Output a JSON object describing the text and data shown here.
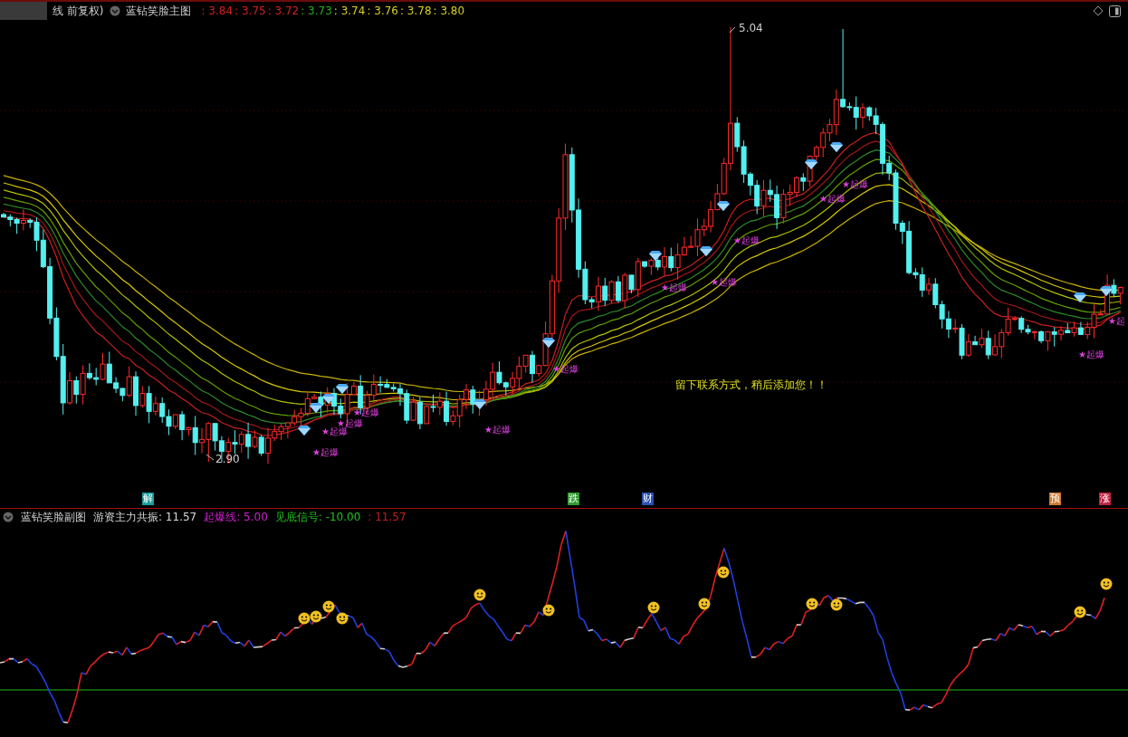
{
  "header": {
    "period": "线 前复权)",
    "indicator": "蓝钻笑脸主图",
    "values": [
      {
        "text": ": 3.84",
        "color": "#d42020"
      },
      {
        "text": ": 3.75",
        "color": "#d42020"
      },
      {
        "text": ": 3.72",
        "color": "#d42020"
      },
      {
        "text": ": 3.73",
        "color": "#20b020"
      },
      {
        "text": ": 3.74",
        "color": "#d8d020"
      },
      {
        "text": ": 3.76",
        "color": "#d8d020"
      },
      {
        "text": ": 3.78",
        "color": "#d8d020"
      },
      {
        "text": ": 3.80",
        "color": "#d8d020"
      }
    ]
  },
  "main_chart": {
    "high_label": "5.04",
    "low_label": "2.90",
    "note": "留下联系方式，稍后添加您！！",
    "signals": [
      {
        "label": "★起爆"
      },
      {
        "label": "★起爆"
      },
      {
        "label": "★起爆"
      },
      {
        "label": "★起爆"
      },
      {
        "label": "★起爆"
      },
      {
        "label": "★起爆"
      },
      {
        "label": "★起爆"
      },
      {
        "label": "★起爆"
      },
      {
        "label": "★起爆"
      },
      {
        "label": "★起爆"
      },
      {
        "label": "★起爆"
      },
      {
        "label": "★起爆"
      },
      {
        "label": "★起"
      }
    ]
  },
  "markers": [
    {
      "label": "解",
      "color": "#1a9c9c"
    },
    {
      "label": "跌",
      "color": "#2f9a2f"
    },
    {
      "label": "财",
      "color": "#2a4fb0"
    },
    {
      "label": "预",
      "color": "#d07a30"
    },
    {
      "label": "涨",
      "color": "#c02040"
    }
  ],
  "sub_header": {
    "indicator": "蓝钻笑脸副图",
    "values": [
      {
        "label": "游资主力共振:",
        "value": "11.57",
        "color": "#d8d8d8"
      },
      {
        "label": "起爆线:",
        "value": "5.00",
        "color": "#d020d0"
      },
      {
        "label": "见底信号:",
        "value": "-10.00",
        "color": "#20c020"
      },
      {
        "label": ":",
        "value": "11.57",
        "color": "#c02020"
      }
    ]
  }
}
